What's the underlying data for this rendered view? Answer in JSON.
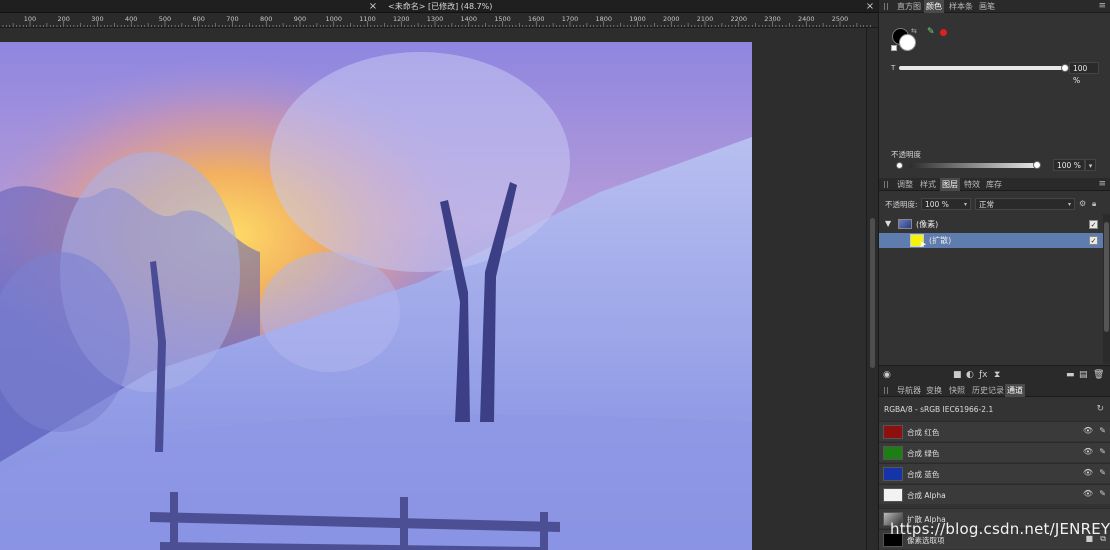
{
  "document": {
    "title": "<未命名> [已修改] (48.7%)",
    "close_glyph": "×"
  },
  "ruler": {
    "labels": [
      "100",
      "200",
      "300",
      "400",
      "500",
      "600",
      "700",
      "800",
      "900",
      "1000",
      "1100",
      "1200",
      "1300",
      "1400",
      "1500",
      "1600",
      "1700",
      "1800",
      "1900",
      "2000",
      "2100",
      "2200",
      "2300",
      "2400",
      "2500"
    ]
  },
  "colors": {
    "panel_bg": "#333333",
    "selected_row": "#5f7cae",
    "accent_red": "#e02020"
  },
  "color_panel": {
    "tabs": [
      "直方图",
      "颜色",
      "样本条",
      "画笔"
    ],
    "active_tab": 1,
    "t_label": "T",
    "t_value": "100 %",
    "t_level": 1.0,
    "opacity_label": "不透明度",
    "opacity_value": "100 %",
    "opacity_level": 1.0
  },
  "layers_panel": {
    "tabs": [
      "调整",
      "样式",
      "图层",
      "特效",
      "库存"
    ],
    "active_tab": 2,
    "opacity_label": "不透明度:",
    "opacity_value": "100 %",
    "blend_mode": "正常",
    "layers": [
      {
        "name": "(像素)",
        "expanded": true,
        "visible": true,
        "selected": false
      },
      {
        "name": "(扩散)",
        "visible": true,
        "selected": true
      }
    ]
  },
  "channels_panel": {
    "tabs": [
      "导航器",
      "变换",
      "快照",
      "历史记录",
      "通道"
    ],
    "active_tab": 4,
    "format": "RGBA/8 - sRGB IEC61966-2.1",
    "channels": [
      {
        "name": "合成 红色",
        "color": "#8c1010"
      },
      {
        "name": "合成 绿色",
        "color": "#1f7d16"
      },
      {
        "name": "合成 蓝色",
        "color": "#1434a8"
      },
      {
        "name": "合成 Alpha",
        "color": "#f2f2f2"
      }
    ],
    "extra": [
      {
        "name": "扩散 Alpha"
      },
      {
        "name": "像素选取项"
      }
    ]
  },
  "watermark": "https://blog.csdn.net/JENREY"
}
